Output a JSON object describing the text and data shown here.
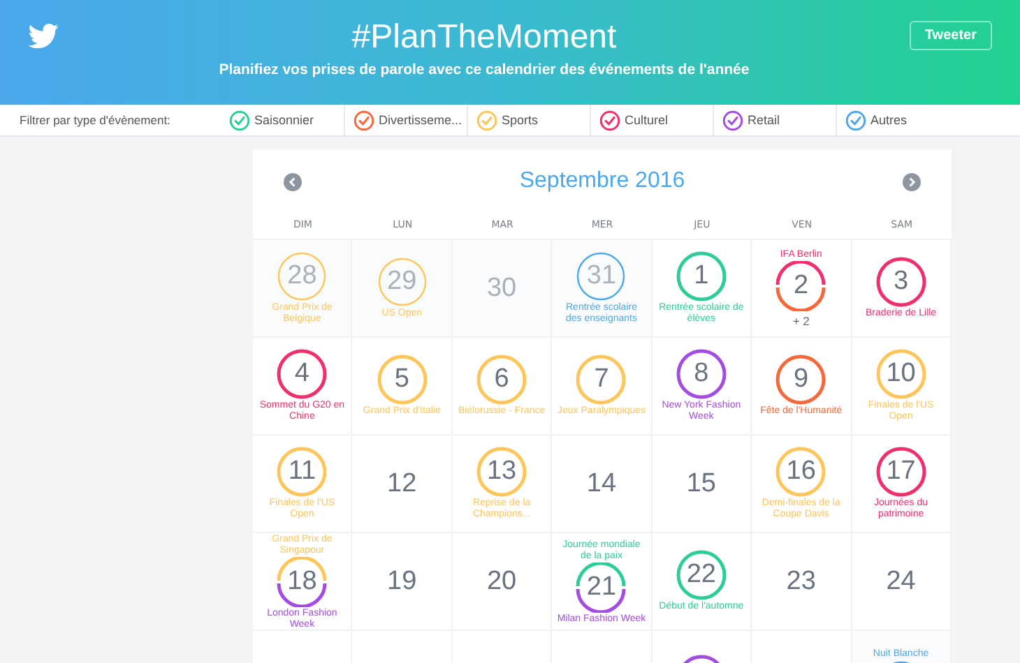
{
  "header": {
    "title": "#PlanTheMoment",
    "subtitle": "Planifiez vos prises de parole avec ce calendrier des événements de l'année",
    "button": "Tweeter"
  },
  "filter": {
    "label": "Filtrer par type d'évènement:",
    "items": [
      {
        "label": "Saisonnier",
        "checked": true,
        "color": "#2ecc9a"
      },
      {
        "label": "Divertisseme...",
        "checked": true,
        "color": "#f5683a"
      },
      {
        "label": "Sports",
        "checked": true,
        "color": "#fdc55a"
      },
      {
        "label": "Culturel",
        "checked": true,
        "color": "#f0306a"
      },
      {
        "label": "Retail",
        "checked": true,
        "color": "#a34de0"
      },
      {
        "label": "Autres",
        "checked": true,
        "color": "#4ea8e8"
      }
    ]
  },
  "calendar": {
    "month": "Septembre 2016",
    "weekdays": [
      "DIM",
      "LUN",
      "MAR",
      "MER",
      "JEU",
      "VEN",
      "SAM"
    ],
    "weeks": [
      [
        {
          "day": "28",
          "faded": true,
          "ring": [
            {
              "color": "#fdc55a"
            }
          ],
          "below": [
            {
              "text": "Grand Prix de Belgique",
              "color": "#fdc55a"
            }
          ]
        },
        {
          "day": "29",
          "faded": true,
          "ring": [
            {
              "color": "#fdc55a"
            }
          ],
          "below": [
            {
              "text": "US Open",
              "color": "#fdc55a"
            }
          ]
        },
        {
          "day": "30",
          "faded": true
        },
        {
          "day": "31",
          "faded": true,
          "ring": [
            {
              "color": "#4ea8e8"
            }
          ],
          "below": [
            {
              "text": "Rentrée scolaire des enseignants",
              "color": "#4ea8e8"
            }
          ]
        },
        {
          "day": "1",
          "faded": false,
          "ring": [
            {
              "color": "#2ecc9a"
            }
          ],
          "below": [
            {
              "text": "Rentrée scolaire de élèves",
              "color": "#2ecc9a"
            }
          ]
        },
        {
          "day": "2",
          "faded": false,
          "above": [
            {
              "text": "IFA Berlin",
              "color": "#f0306a"
            }
          ],
          "ring": [
            {
              "color": "#f0306a"
            },
            {
              "color": "#f5683a"
            }
          ],
          "more": "+ 2"
        },
        {
          "day": "3",
          "faded": false,
          "ring": [
            {
              "color": "#f0306a"
            }
          ],
          "below": [
            {
              "text": "Braderie de Lille",
              "color": "#f0306a"
            }
          ]
        }
      ],
      [
        {
          "day": "4",
          "faded": false,
          "ring": [
            {
              "color": "#f0306a"
            }
          ],
          "below": [
            {
              "text": "Sommet du G20 en Chine",
              "color": "#f0306a"
            }
          ]
        },
        {
          "day": "5",
          "faded": false,
          "ring": [
            {
              "color": "#fdc55a"
            }
          ],
          "below": [
            {
              "text": "Grand Prix d'Italie",
              "color": "#fdc55a"
            }
          ]
        },
        {
          "day": "6",
          "faded": false,
          "ring": [
            {
              "color": "#fdc55a"
            }
          ],
          "below": [
            {
              "text": "Biélorussie - France",
              "color": "#fdc55a"
            }
          ]
        },
        {
          "day": "7",
          "faded": false,
          "ring": [
            {
              "color": "#fdc55a"
            }
          ],
          "below": [
            {
              "text": "Jeux Paralympiques",
              "color": "#fdc55a"
            }
          ]
        },
        {
          "day": "8",
          "faded": false,
          "ring": [
            {
              "color": "#a34de0"
            }
          ],
          "below": [
            {
              "text": "New York Fashion Week",
              "color": "#a34de0"
            }
          ]
        },
        {
          "day": "9",
          "faded": false,
          "ring": [
            {
              "color": "#f5683a"
            }
          ],
          "below": [
            {
              "text": "Fête de l'Humanité",
              "color": "#f5683a"
            }
          ]
        },
        {
          "day": "10",
          "faded": false,
          "ring": [
            {
              "color": "#fdc55a"
            }
          ],
          "below": [
            {
              "text": "Finales de l'US Open",
              "color": "#fdc55a"
            }
          ]
        }
      ],
      [
        {
          "day": "11",
          "faded": false,
          "ring": [
            {
              "color": "#fdc55a"
            }
          ],
          "below": [
            {
              "text": "Finales de l'US Open",
              "color": "#fdc55a"
            }
          ]
        },
        {
          "day": "12",
          "faded": false
        },
        {
          "day": "13",
          "faded": false,
          "ring": [
            {
              "color": "#fdc55a"
            }
          ],
          "below": [
            {
              "text": "Reprise de la Champions...",
              "color": "#fdc55a"
            }
          ]
        },
        {
          "day": "14",
          "faded": false
        },
        {
          "day": "15",
          "faded": false
        },
        {
          "day": "16",
          "faded": false,
          "ring": [
            {
              "color": "#fdc55a"
            }
          ],
          "below": [
            {
              "text": "Demi-finales de la Coupe Davis",
              "color": "#fdc55a"
            }
          ]
        },
        {
          "day": "17",
          "faded": false,
          "ring": [
            {
              "color": "#f0306a"
            }
          ],
          "below": [
            {
              "text": "Journées du patrimoine",
              "color": "#f0306a"
            }
          ]
        }
      ],
      [
        {
          "day": "18",
          "faded": false,
          "above": [
            {
              "text": "Grand Prix de Singapour",
              "color": "#fdc55a"
            }
          ],
          "ring": [
            {
              "color": "#fdc55a"
            },
            {
              "color": "#a34de0"
            }
          ],
          "below": [
            {
              "text": "London Fashion Week",
              "color": "#a34de0"
            }
          ]
        },
        {
          "day": "19",
          "faded": false
        },
        {
          "day": "20",
          "faded": false
        },
        {
          "day": "21",
          "faded": false,
          "above": [
            {
              "text": "Journée mondiale de la paix",
              "color": "#2ecc9a"
            }
          ],
          "ring": [
            {
              "color": "#2ecc9a"
            },
            {
              "color": "#a34de0"
            }
          ],
          "below": [
            {
              "text": "Milan Fashion Week",
              "color": "#a34de0"
            }
          ]
        },
        {
          "day": "22",
          "faded": false,
          "ring": [
            {
              "color": "#2ecc9a"
            }
          ],
          "below": [
            {
              "text": "Début de l'automne",
              "color": "#2ecc9a"
            }
          ]
        },
        {
          "day": "23",
          "faded": false
        },
        {
          "day": "24",
          "faded": false
        }
      ],
      [
        {
          "kind": "blank"
        },
        {
          "kind": "blank"
        },
        {
          "kind": "blank"
        },
        {
          "kind": "blank"
        },
        {
          "faded": false,
          "ring": [
            {
              "color": "#a34de0"
            }
          ]
        },
        {
          "kind": "blank"
        },
        {
          "faded": true,
          "above": [
            {
              "text": "Nuit Blanche",
              "color": "#4ea8e8"
            }
          ],
          "ring": [
            {
              "color": "#4ea8e8"
            }
          ]
        }
      ]
    ]
  }
}
